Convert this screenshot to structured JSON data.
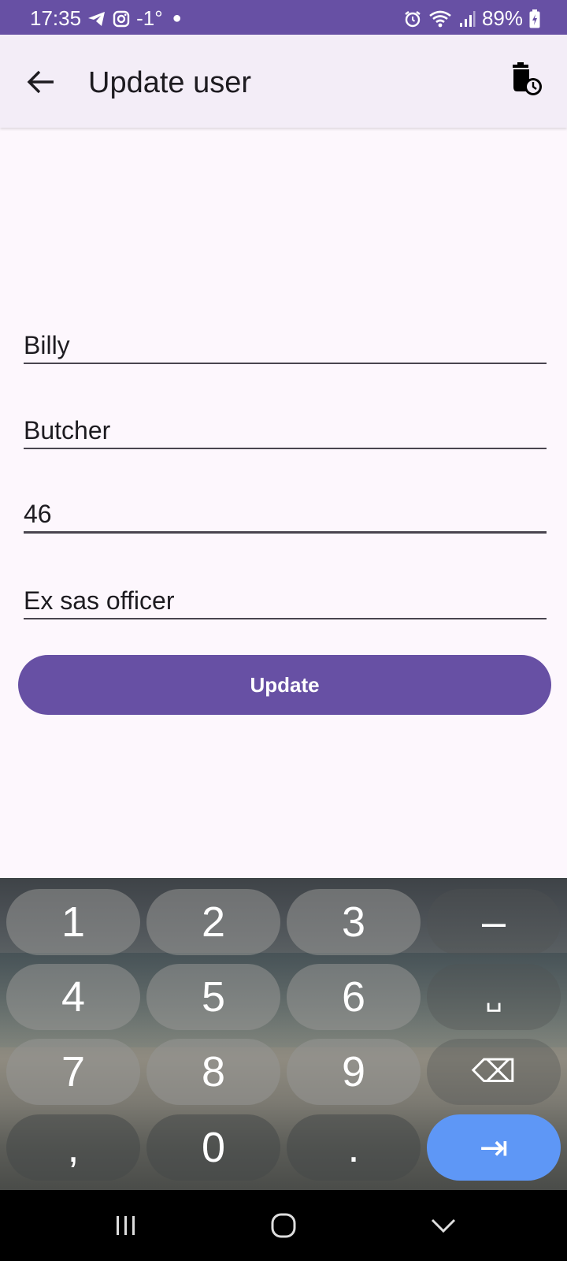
{
  "status_bar": {
    "time": "17:35",
    "temperature": "-1°",
    "battery": "89%",
    "bg_color": "#6750a4"
  },
  "app_bar": {
    "title": "Update user"
  },
  "form": {
    "fields": [
      {
        "value": "Billy"
      },
      {
        "value": "Butcher"
      },
      {
        "value": "46"
      },
      {
        "value": "Ex sas officer"
      }
    ],
    "submit_label": "Update",
    "accent_color": "#6750a4"
  },
  "keyboard": {
    "rows": [
      [
        "1",
        "2",
        "3",
        "–"
      ],
      [
        "4",
        "5",
        "6",
        "␣"
      ],
      [
        "7",
        "8",
        "9",
        "⌫"
      ],
      [
        ",",
        "0",
        ".",
        "⇥"
      ]
    ],
    "action_key_color": "#5e97f6"
  },
  "nav_bar": {
    "items": [
      "recent-apps",
      "home",
      "back"
    ]
  }
}
